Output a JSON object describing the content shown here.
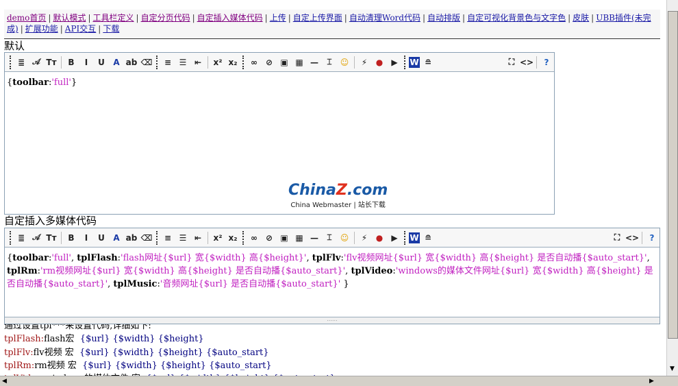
{
  "nav": [
    {
      "label": "demo首页",
      "visited": true
    },
    {
      "label": "默认模式",
      "visited": true
    },
    {
      "label": "工具栏定义",
      "visited": true
    },
    {
      "label": "自定分页代码",
      "visited": true
    },
    {
      "label": "自定插入媒体代码",
      "visited": true
    },
    {
      "label": "上传",
      "visited": false
    },
    {
      "label": "自定上传界面",
      "visited": false
    },
    {
      "label": "自动清理Word代码",
      "visited": false
    },
    {
      "label": "自动排版",
      "visited": false
    },
    {
      "label": "自定可视化背景色与文字色",
      "visited": false
    },
    {
      "label": "皮肤",
      "visited": false
    },
    {
      "label": "UBB插件(未完成)",
      "visited": false
    },
    {
      "label": "扩展功能",
      "visited": false
    },
    {
      "label": "API交互",
      "visited": false
    },
    {
      "label": "下载",
      "visited": false
    }
  ],
  "section1": {
    "title": "默认",
    "content": {
      "key": "toolbar",
      "val": "'full'"
    }
  },
  "section2": {
    "title": "自定插入多媒体代码",
    "content": [
      {
        "k": "toolbar",
        "v": "'full'"
      },
      {
        "k": "tplFlash",
        "v": "'flash网址{$url} 宽{$width} 高{$height}'"
      },
      {
        "k": "tplFlv",
        "v": "'flv视频网址{$url} 宽{$width} 高{$height} 是否自动播{$auto_start}'"
      },
      {
        "k": "tplRm",
        "v": "'rm视频网址{$url} 宽{$width} 高{$height} 是否自动播{$auto_start}'"
      },
      {
        "k": "tplVideo",
        "v": "'windows的媒体文件网址{$url} 宽{$width} 高{$height} 是否自动播{$auto_start}'"
      },
      {
        "k": "tplMusic",
        "v": "'音频网址{$url} 是否自动播{$auto_start}'"
      }
    ]
  },
  "watermark": {
    "brand": "ChinaZ.com",
    "sub": "China Webmaster | 站长下载"
  },
  "notes": {
    "intro": "通过设置tpl***来设置代码,详细如下:",
    "lines": [
      {
        "k": "tplFlash:",
        "d": "flash宏",
        "m": "{$url} {$width} {$height}"
      },
      {
        "k": "tplFlv:",
        "d": "flv视频 宏",
        "m": "{$url} {$width} {$height} {$auto_start}"
      },
      {
        "k": "tplRm:",
        "d": "rm视频 宏",
        "m": "{$url} {$width} {$height} {$auto_start}"
      },
      {
        "k": "tplVideo:",
        "d": "windows的媒体文件 宏",
        "m": "{$url} {$width} {$height} {$auto_start}"
      }
    ]
  }
}
